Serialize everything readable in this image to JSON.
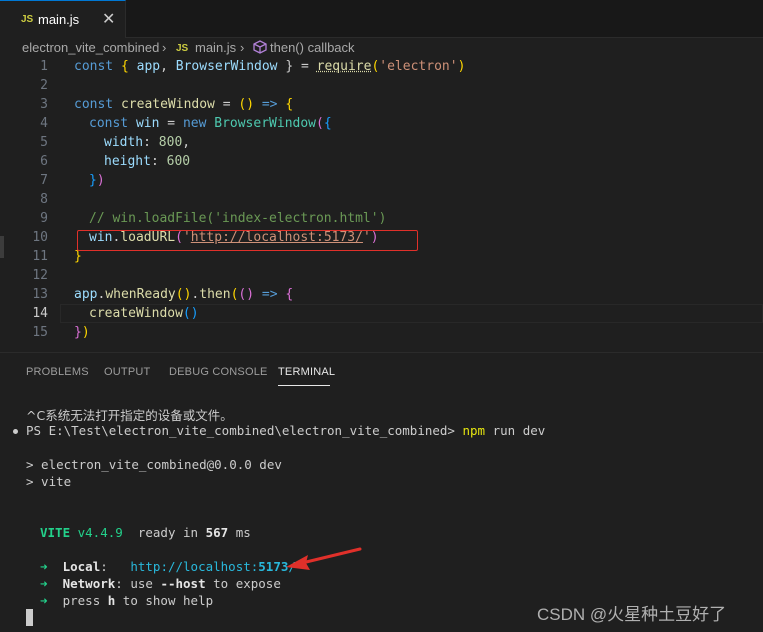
{
  "tabbar": {
    "file_icon": "JS",
    "file_name": "main.js",
    "close": "✕"
  },
  "breadcrumb": {
    "folder": "electron_vite_combined",
    "sep1": "›",
    "file_icon": "JS",
    "file": "main.js",
    "sep2": "›",
    "symbol": "then() callback"
  },
  "editor": {
    "line_numbers": [
      "1",
      "2",
      "3",
      "4",
      "5",
      "6",
      "7",
      "8",
      "9",
      "10",
      "11",
      "12",
      "13",
      "14",
      "15"
    ],
    "active_line": "14",
    "lines": {
      "l1": [
        "const ",
        "{ ",
        "app",
        ", ",
        "BrowserWindow",
        " } = ",
        "require",
        "(",
        "'electron'",
        ")"
      ],
      "l3": [
        "const ",
        "createWindow",
        " = ",
        "()",
        " => ",
        "{"
      ],
      "l4": [
        "const ",
        "win",
        " = ",
        "new ",
        "BrowserWindow",
        "(",
        "{"
      ],
      "l5": [
        "width",
        ": ",
        "800",
        ","
      ],
      "l6": [
        "height",
        ": ",
        "600"
      ],
      "l7": [
        "}",
        ")"
      ],
      "l9": "// win.loadFile('index-electron.html')",
      "l10": [
        "win",
        ".",
        "loadURL",
        "(",
        "'",
        "http://localhost:5173/",
        "'",
        ")"
      ],
      "l11": "}",
      "l13": [
        "app",
        ".",
        "whenReady",
        "(",
        ")",
        ".",
        "then",
        "(",
        "()",
        " => ",
        "{"
      ],
      "l14": [
        "createWindow",
        "()"
      ],
      "l15": [
        "}",
        ")"
      ]
    }
  },
  "panel": {
    "tabs": [
      "PROBLEMS",
      "OUTPUT",
      "DEBUG CONSOLE",
      "TERMINAL"
    ],
    "active_tab": "TERMINAL"
  },
  "terminal": {
    "error_line": "^C系统无法打开指定的设备或文件。",
    "prompt": "PS E:\\Test\\electron_vite_combined\\electron_vite_combined> ",
    "command": "npm",
    "command_args": " run dev",
    "script_line1": "> electron_vite_combined@0.0.0 dev",
    "script_line2": "> vite",
    "vite_name": "VITE",
    "vite_version": " v4.4.9",
    "ready_prefix": "  ready in ",
    "ready_ms": "567",
    "ready_suffix": " ms",
    "arrow": "➜",
    "local_label": "Local",
    "local_colon": ":   ",
    "local_url_prefix": "http://localhost:",
    "local_port": "5173",
    "local_url_suffix": "/",
    "network_label": "Network",
    "network_text1": ": use ",
    "network_flag": "--host",
    "network_text2": " to expose",
    "help_prefix": "press ",
    "help_key": "h",
    "help_suffix": " to show help"
  },
  "watermark": "CSDN @火星种土豆好了",
  "colors": {
    "accent": "#0078d4",
    "highlight_box": "#e0302a",
    "arrow": "#e0302a"
  }
}
